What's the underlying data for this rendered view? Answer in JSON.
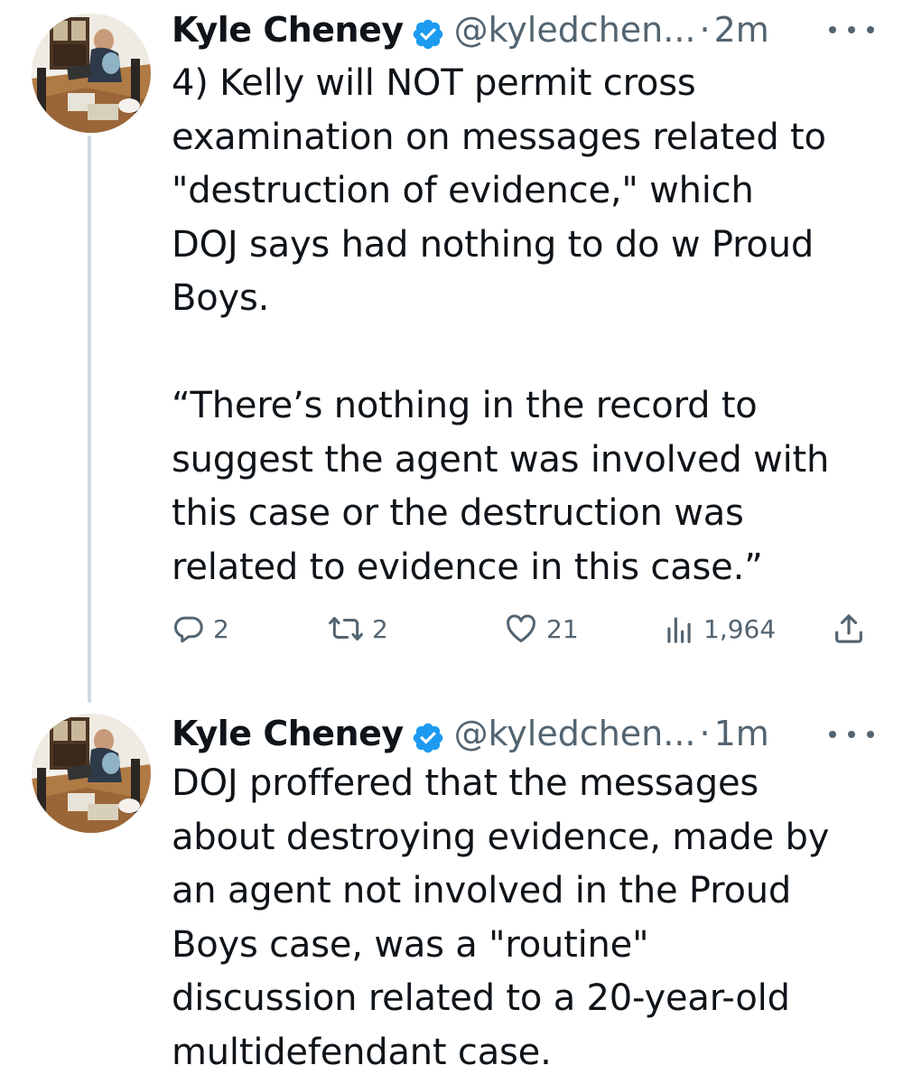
{
  "tweets": [
    {
      "author": {
        "name": "Kyle Cheney",
        "handle": "@kyledchen...",
        "verified": true
      },
      "separator": "·",
      "time": "2m",
      "text": "4) Kelly will NOT permit cross\nexamination on messages related to\n\"destruction of evidence,\" which\nDOJ says had nothing to do w Proud\nBoys.\n\n“There’s nothing in the record to\nsuggest the agent was involved with\nthis case or the destruction was\nrelated to evidence in this case.”",
      "metrics": {
        "replies": "2",
        "reposts": "2",
        "likes": "21",
        "views": "1,964"
      }
    },
    {
      "author": {
        "name": "Kyle Cheney",
        "handle": "@kyledchen...",
        "verified": true
      },
      "separator": "·",
      "time": "1m",
      "text": "DOJ proffered that the messages\nabout destroying evidence, made by\nan agent not involved in the Proud\nBoys case, was a \"routine\"\ndiscussion related to a 20-year-old\nmultidefendant case."
    }
  ],
  "icons": {
    "verified_badge": "verified-badge-icon",
    "more": "more-icon",
    "reply": "reply-icon",
    "repost": "repost-icon",
    "like": "like-icon",
    "views": "views-icon",
    "share": "share-icon"
  },
  "colors": {
    "text_primary": "#0f1419",
    "text_secondary": "#536471",
    "verified": "#1d9bf0",
    "thread_line": "#cfd9de"
  }
}
